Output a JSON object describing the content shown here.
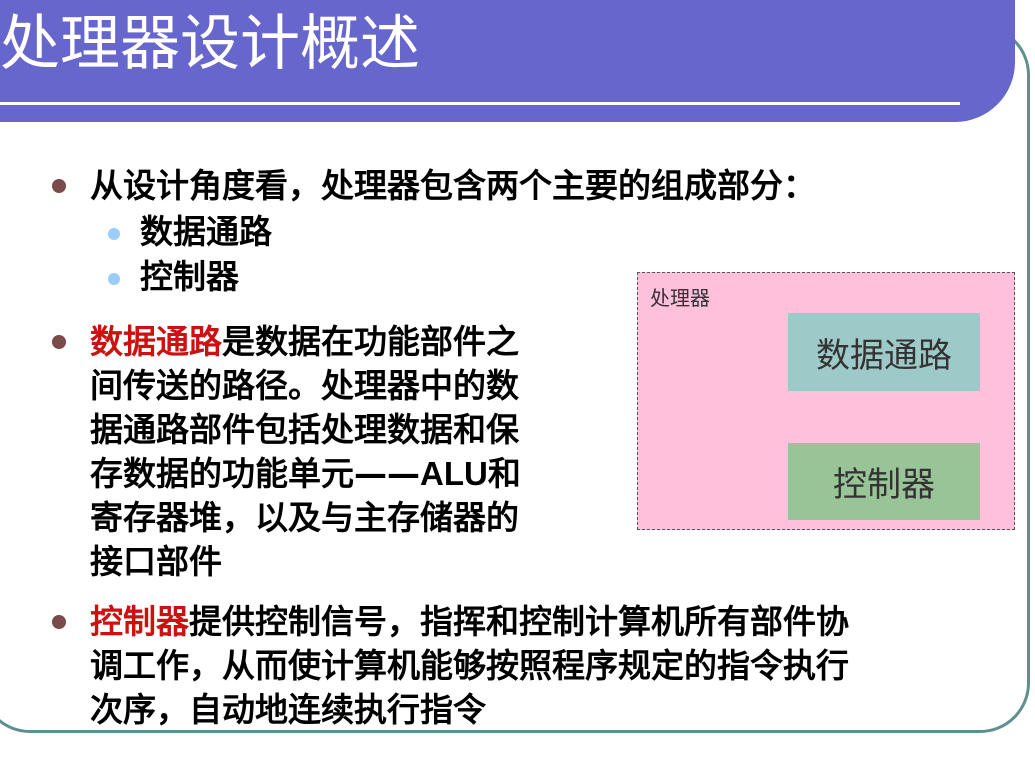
{
  "title": "处理器设计概述",
  "bullets": {
    "b1": "从设计角度看，处理器包含两个主要的组成部分：",
    "sub1": "数据通路",
    "sub2": "控制器",
    "b2": {
      "highlight": "数据通路",
      "line1_rest": "是数据在功能部件之",
      "line2": "间传送的路径。处理器中的数",
      "line3": "据通路部件包括处理数据和保",
      "line4_pre": "存数据的功能单元——",
      "line4_alu": "ALU",
      "line4_post": "和",
      "line5": "寄存器堆，以及与主存储器的",
      "line6": "接口部件"
    },
    "b3": {
      "highlight": "控制器",
      "line1_rest": "提供控制信号，指挥和控制计算机所有部件协",
      "line2": "调工作，从而使计算机能够按照程序规定的指令执行",
      "line3": "次序，自动地连续执行指令"
    }
  },
  "diagram": {
    "container_label": "处理器",
    "datapath_label": "数据通路",
    "control_label": "控制器"
  },
  "colors": {
    "title_bar": "#6666cc",
    "highlight": "#cc1111",
    "diagram_bg": "#ffc0dc",
    "datapath_bg": "#9ec9c9",
    "control_bg": "#98c497"
  }
}
